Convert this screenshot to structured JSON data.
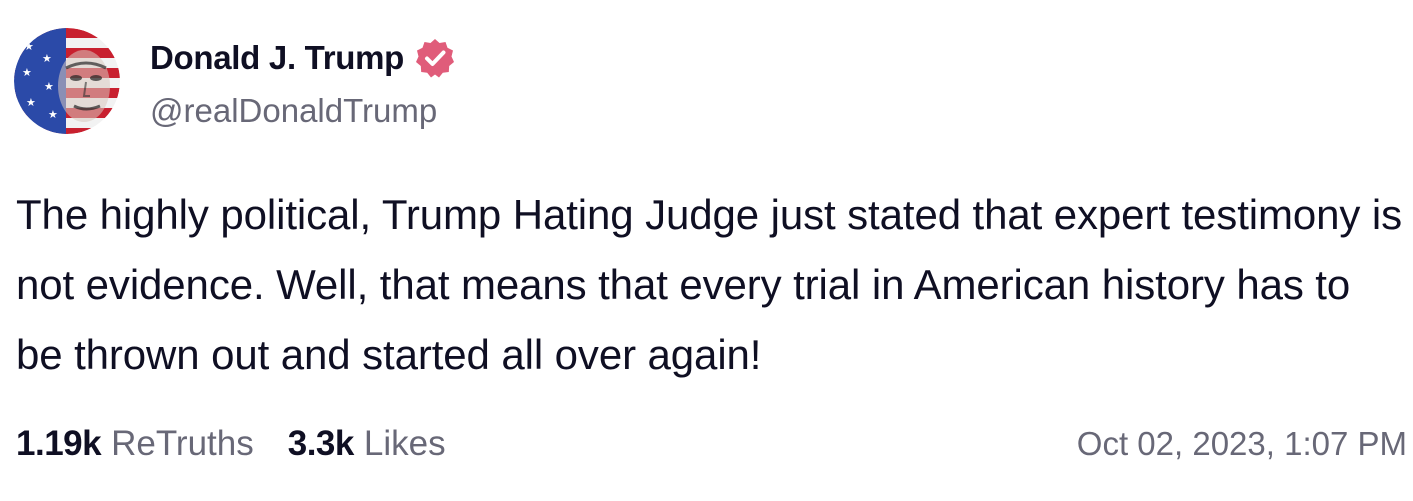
{
  "author": {
    "display_name": "Donald J. Trump",
    "handle": "@realDonaldTrump",
    "verified": true,
    "verified_icon": "verified-badge-icon",
    "verified_color": "#e05c7a"
  },
  "post": {
    "text": "The highly political, Trump Hating Judge just stated that expert testimony is not evidence. Well, that means that every trial in American history has to be thrown out and started all over again!",
    "timestamp": "Oct 02, 2023, 1:07 PM"
  },
  "stats": {
    "retruths_count": "1.19k",
    "retruths_label": "ReTruths",
    "likes_count": "3.3k",
    "likes_label": "Likes"
  },
  "colors": {
    "text_primary": "#0f0f23",
    "text_secondary": "#686877",
    "background": "#ffffff"
  }
}
